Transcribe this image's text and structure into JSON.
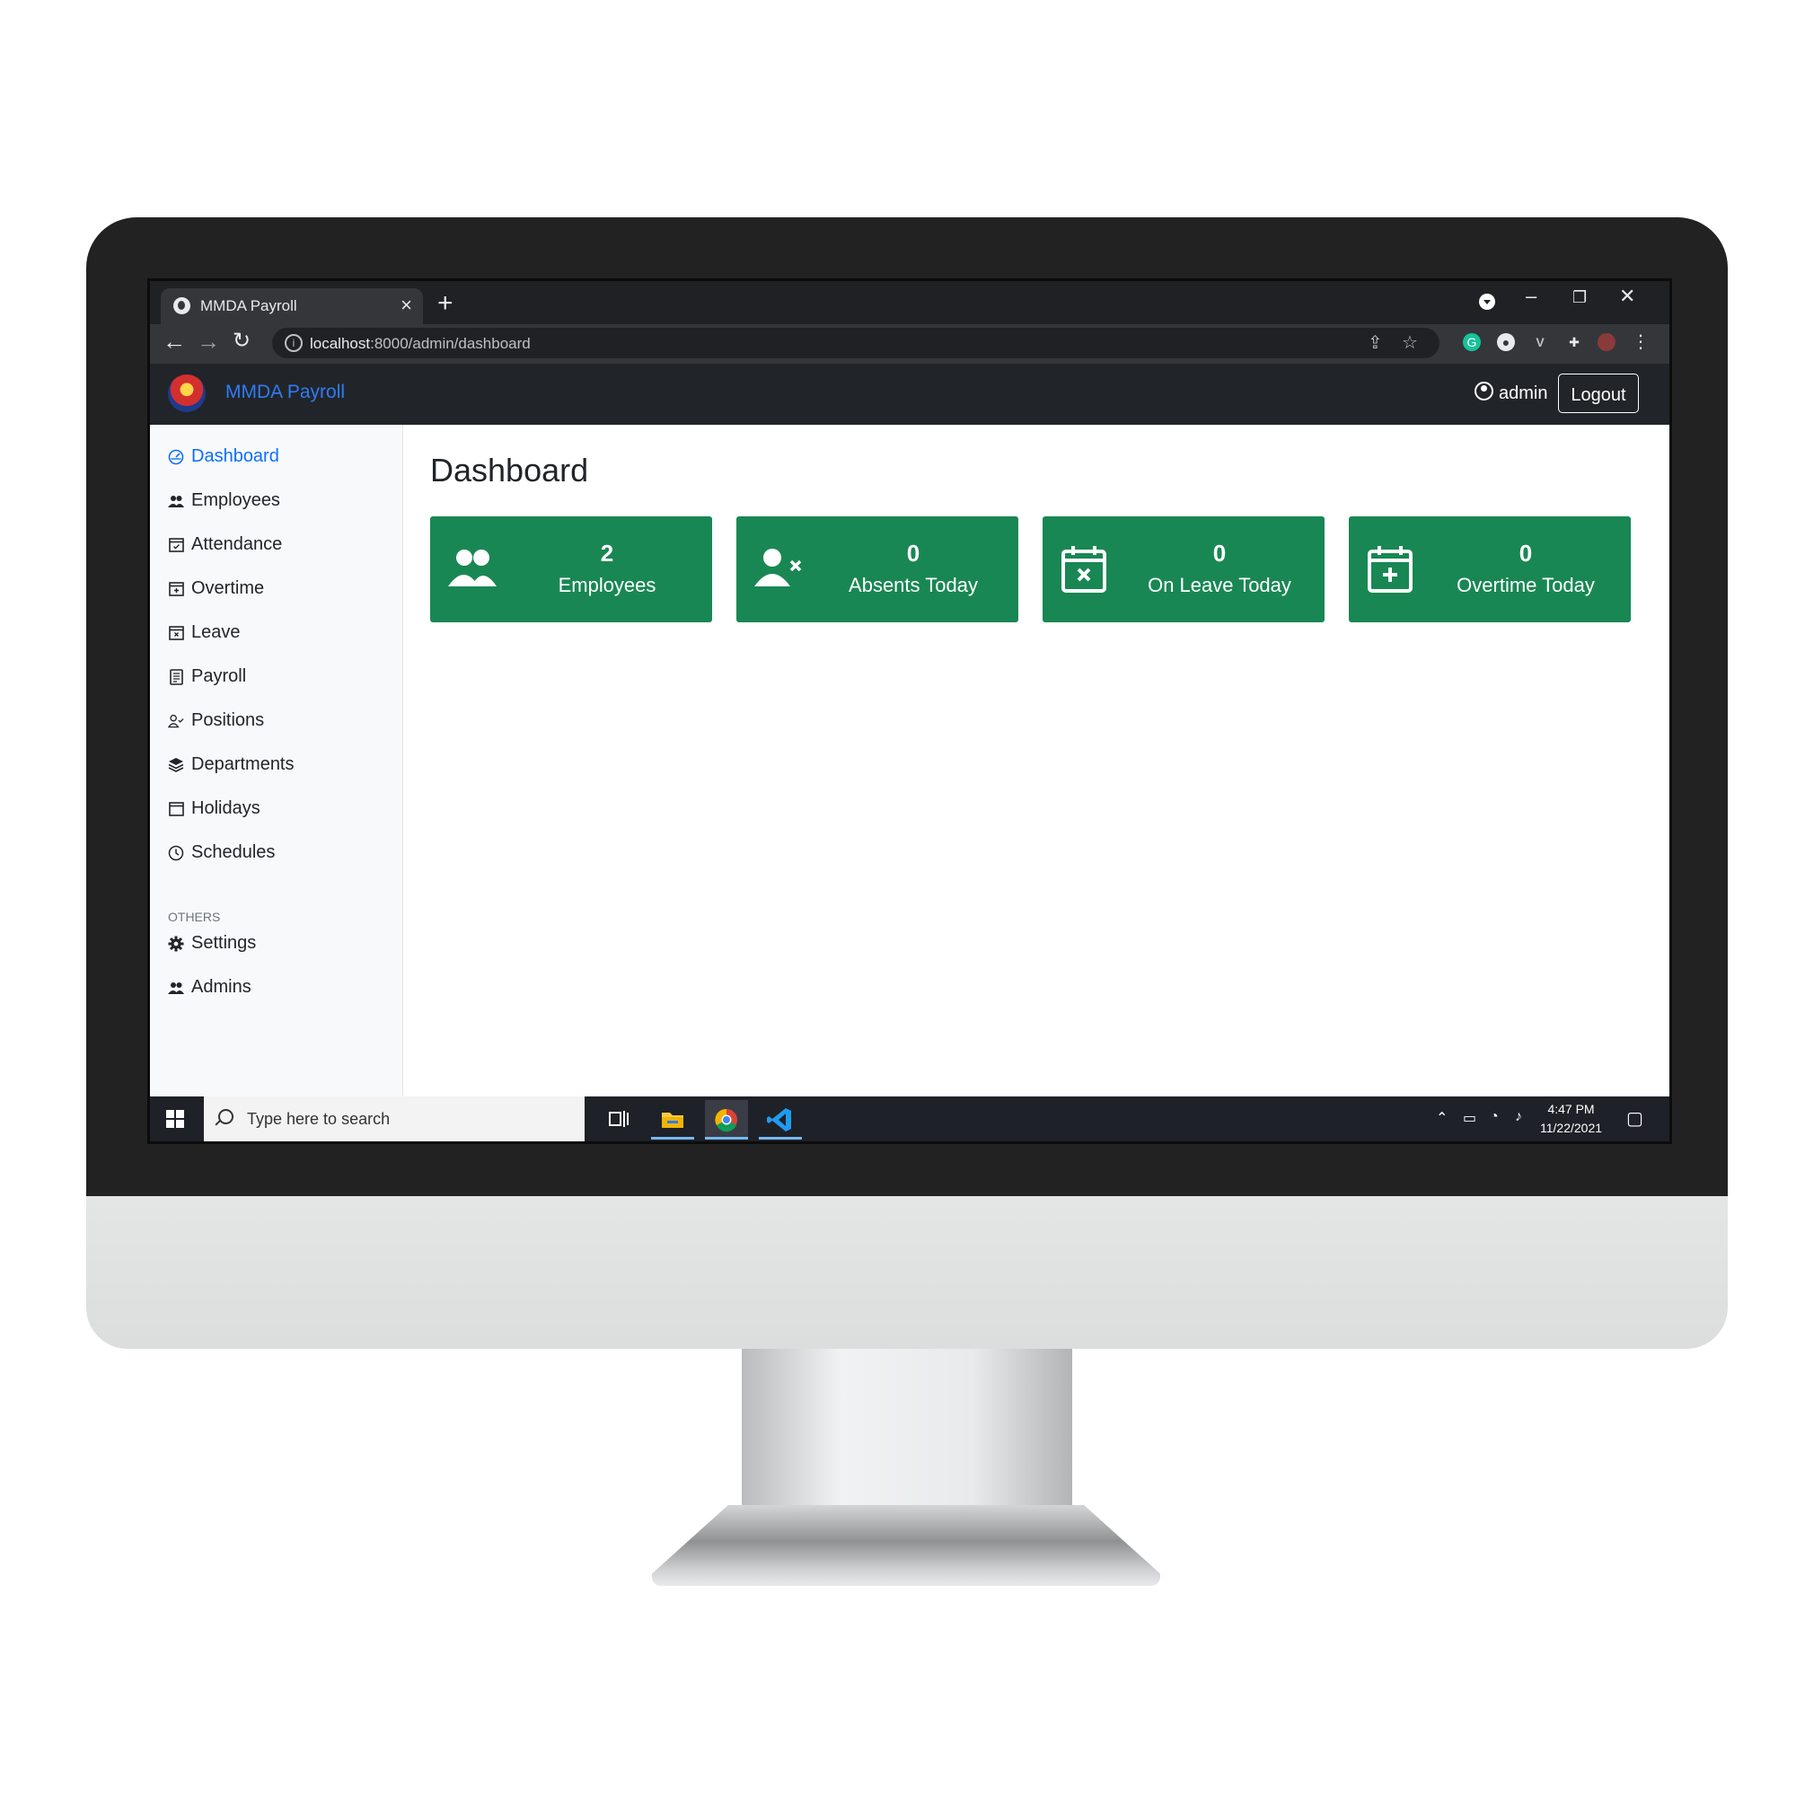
{
  "browser": {
    "tab_title": "MMDA Payroll",
    "new_tab": "+",
    "url_host": "localhost",
    "url_rest": ":8000/admin/dashboard"
  },
  "app": {
    "brand": "MMDA Payroll",
    "user": "admin",
    "logout": "Logout"
  },
  "sidebar": {
    "items": [
      {
        "label": "Dashboard",
        "icon": "dashboard-icon"
      },
      {
        "label": "Employees",
        "icon": "people-icon"
      },
      {
        "label": "Attendance",
        "icon": "calendar-check-icon"
      },
      {
        "label": "Overtime",
        "icon": "calendar-plus-icon"
      },
      {
        "label": "Leave",
        "icon": "calendar-x-icon"
      },
      {
        "label": "Payroll",
        "icon": "document-icon"
      },
      {
        "label": "Positions",
        "icon": "person-check-icon"
      },
      {
        "label": "Departments",
        "icon": "layers-icon"
      },
      {
        "label": "Holidays",
        "icon": "calendar-icon"
      },
      {
        "label": "Schedules",
        "icon": "clock-icon"
      }
    ],
    "others_heading": "OTHERS",
    "others": [
      {
        "label": "Settings",
        "icon": "gear-icon"
      },
      {
        "label": "Admins",
        "icon": "people-icon"
      }
    ]
  },
  "main": {
    "title": "Dashboard",
    "cards": [
      {
        "value": "2",
        "label": "Employees",
        "icon": "people-icon"
      },
      {
        "value": "0",
        "label": "Absents Today",
        "icon": "person-x-icon"
      },
      {
        "value": "0",
        "label": "On Leave Today",
        "icon": "calendar-x-icon"
      },
      {
        "value": "0",
        "label": "Overtime Today",
        "icon": "calendar-plus-icon"
      }
    ],
    "card_color": "#198754"
  },
  "taskbar": {
    "search_placeholder": "Type here to search",
    "time": "4:47 PM",
    "date": "11/22/2021"
  }
}
